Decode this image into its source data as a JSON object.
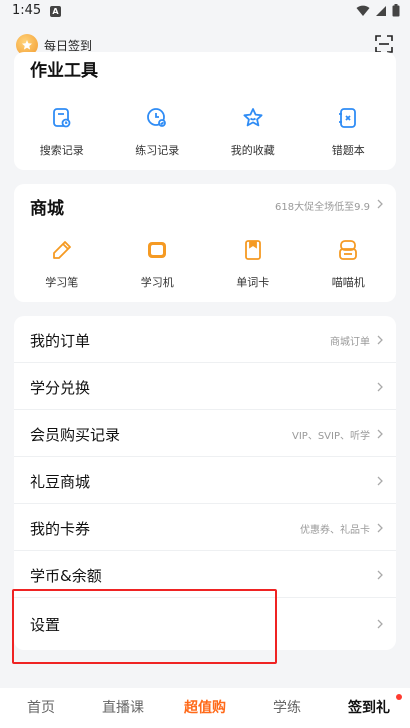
{
  "status": {
    "time": "1:45"
  },
  "header": {
    "daily_label": "每日签到"
  },
  "tools": {
    "title": "作业工具",
    "items": [
      {
        "label": "搜索记录",
        "icon": "search-record-icon"
      },
      {
        "label": "练习记录",
        "icon": "clock-icon"
      },
      {
        "label": "我的收藏",
        "icon": "star-icon"
      },
      {
        "label": "错题本",
        "icon": "wrong-book-icon"
      }
    ]
  },
  "mall": {
    "title": "商城",
    "promo": "618大促全场低至9.9",
    "items": [
      {
        "label": "学习笔",
        "icon": "pen-icon"
      },
      {
        "label": "学习机",
        "icon": "tablet-icon"
      },
      {
        "label": "单词卡",
        "icon": "word-card-icon"
      },
      {
        "label": "喵喵机",
        "icon": "printer-icon"
      }
    ]
  },
  "menu": {
    "rows": [
      {
        "label": "我的订单",
        "sub": "商城订单"
      },
      {
        "label": "学分兑换",
        "sub": ""
      },
      {
        "label": "会员购买记录",
        "sub": "VIP、SVIP、听学"
      },
      {
        "label": "礼豆商城",
        "sub": ""
      },
      {
        "label": "我的卡券",
        "sub": "优惠券、礼品卡"
      },
      {
        "label": "学币&余额",
        "sub": ""
      },
      {
        "label": "设置",
        "sub": ""
      }
    ]
  },
  "tabbar": {
    "tabs": [
      {
        "label": "首页"
      },
      {
        "label": "直播课"
      },
      {
        "label": "超值购"
      },
      {
        "label": "学练"
      },
      {
        "label": "签到礼"
      }
    ]
  },
  "colors": {
    "accent": "#2f8cf5",
    "tab_active": "#ff6a1a",
    "highlight": "#ef2323",
    "mall_icon": "#f59a23"
  }
}
